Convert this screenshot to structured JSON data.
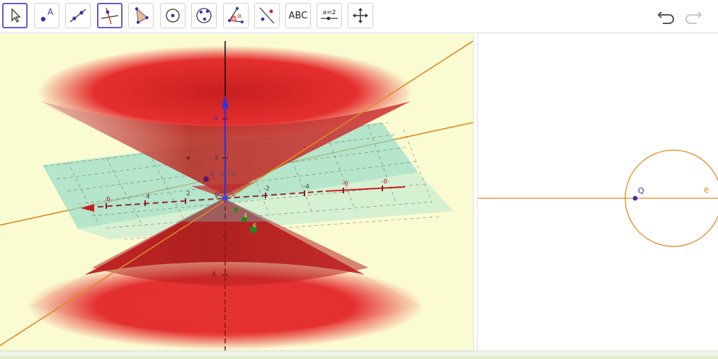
{
  "toolbar": {
    "tools": [
      {
        "name": "move-tool",
        "active": true
      },
      {
        "name": "point-tool",
        "glyph": "A"
      },
      {
        "name": "line-tool"
      },
      {
        "name": "perpendicular-line-tool",
        "active": true
      },
      {
        "name": "polygon-tool"
      },
      {
        "name": "circle-center-point-tool"
      },
      {
        "name": "circle-three-points-tool"
      },
      {
        "name": "angle-tool",
        "glyph": "α"
      },
      {
        "name": "reflect-about-line-tool"
      },
      {
        "name": "text-tool",
        "label": "ABC"
      },
      {
        "name": "slider-tool",
        "label": "a=2"
      },
      {
        "name": "move-graphics-view-tool"
      }
    ],
    "undo_label": "undo",
    "redo_label": "redo"
  },
  "view3d": {
    "axis_labels": {
      "z_top": "4",
      "z_mid": "2",
      "z_neg": "-4",
      "origin": "0",
      "x_left": [
        "6",
        "4",
        "2"
      ],
      "y_right": [
        "-2",
        "-4",
        "-6",
        "-8"
      ],
      "green": [
        "4",
        "6"
      ],
      "small_left": "Q"
    }
  },
  "view2d": {
    "point_label": "Q",
    "curve_label": "e"
  },
  "colors": {
    "accent": "#6557d2",
    "cone": "#e32a2a",
    "plane": "#8fd9c8",
    "orange": "#e48a1a",
    "view_bg": "#fbfbd2",
    "point": "#3b2fb5"
  }
}
